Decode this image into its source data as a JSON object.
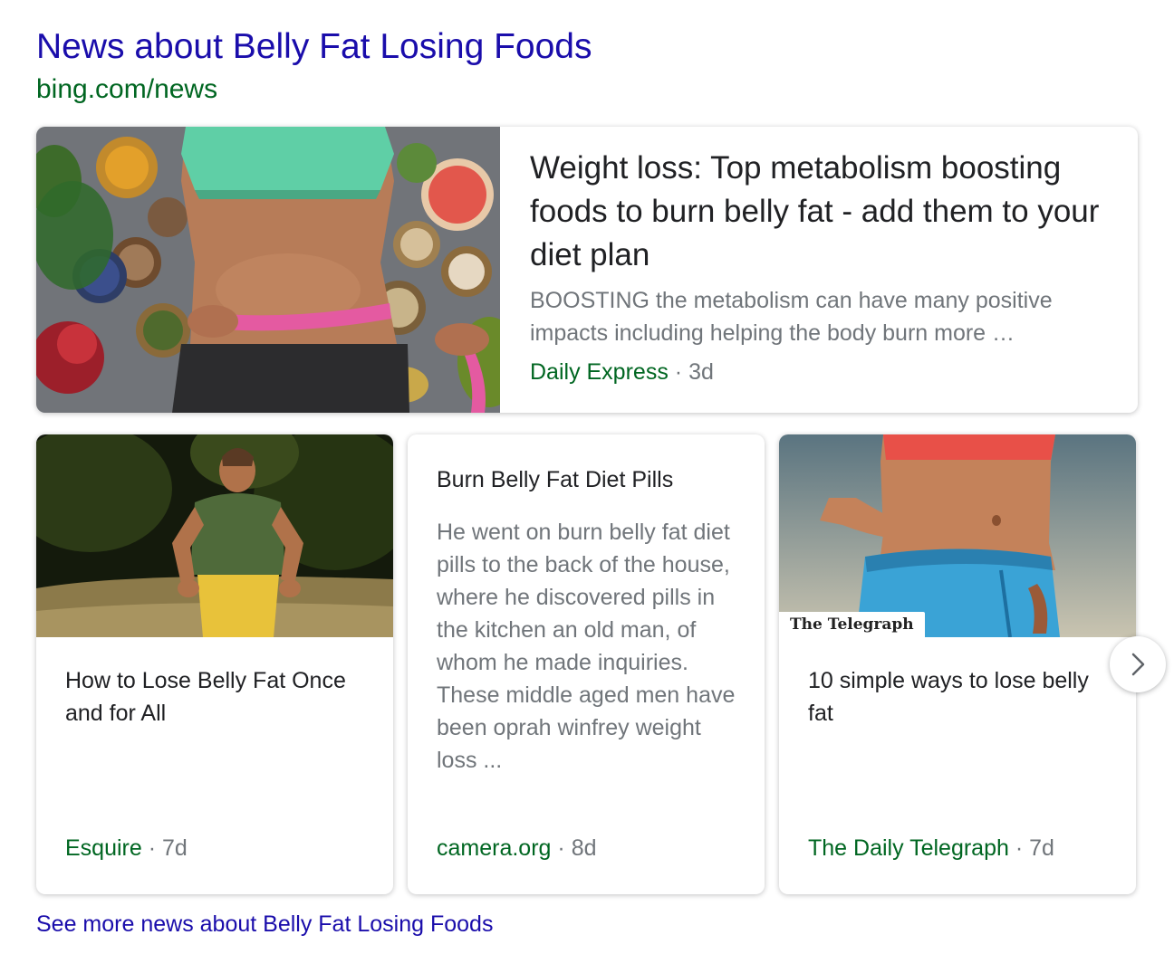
{
  "header": {
    "title": "News about Belly Fat Losing Foods",
    "url": "bing.com/news"
  },
  "featured": {
    "title": "Weight loss: Top metabolism boosting foods to burn belly fat - add them to your diet plan",
    "snippet": "BOOSTING the metabolism can have many positive impacts including helping the body burn more …",
    "source": "Daily Express",
    "separator": "·",
    "age": "3d"
  },
  "cards": [
    {
      "title": "How to Lose Belly Fat Once and for All",
      "source": "Esquire",
      "separator": "·",
      "age": "7d"
    },
    {
      "title": "Burn Belly Fat Diet Pills",
      "snippet": "He went on burn belly fat diet pills to the back of the house, where he discovered pills in the kitchen an old man, of whom he made inquiries. These middle aged men have been oprah winfrey weight loss ...",
      "source": "camera.org",
      "separator": "·",
      "age": "8d"
    },
    {
      "title": "10 simple ways to lose belly fat",
      "source": "The Daily Telegraph",
      "separator": "·",
      "age": "7d",
      "badge": "The Telegraph"
    }
  ],
  "next_icon": "chevron-right-icon",
  "see_more": "See more news about Belly Fat Losing Foods",
  "colors": {
    "link": "#1a0dab",
    "url_green": "#006621",
    "muted": "#70757a",
    "text": "#202124"
  }
}
